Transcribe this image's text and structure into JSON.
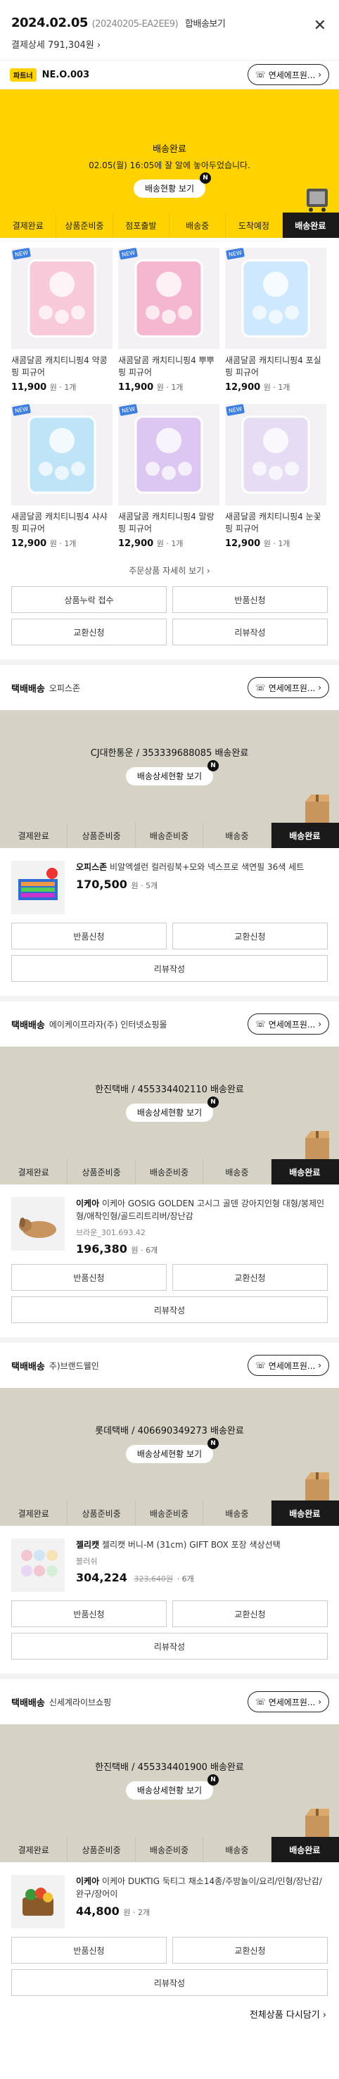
{
  "header": {
    "date": "2024.02.05",
    "order_id": "(20240205-EA2EE9)",
    "merge_label": "합배송보기",
    "total": "결제상세 791,304원",
    "close_icon": "close-icon"
  },
  "store1": {
    "badge": "파트너",
    "name": "NE.O.003",
    "contact": "연세에프원..."
  },
  "status1": {
    "title": "배송완료",
    "sub": "02.05(월) 16:05에 잘 알에 놓아두었습니다.",
    "track": "배송현황 보기",
    "steps": [
      "결제완료",
      "상품준비중",
      "점포출발",
      "배송중",
      "도착예정",
      "배송완료"
    ],
    "active": 5
  },
  "grid_items": [
    {
      "name": "새콤달콤 캐치티니핑4 약콩 핑 피규어",
      "price": "11,900",
      "unit": "원 · 1개"
    },
    {
      "name": "새콤달콤 캐치티니핑4 뿌뿌 핑 피규어",
      "price": "11,900",
      "unit": "원 · 1개"
    },
    {
      "name": "새콤달콤 캐치티니핑4 포실 핑 피규어",
      "price": "12,900",
      "unit": "원 · 1개"
    },
    {
      "name": "새콤달콤 캐치티니핑4 샤샤 핑 피규어",
      "price": "12,900",
      "unit": "원 · 1개"
    },
    {
      "name": "새콤달콤 캐치티니핑4 말랑 핑 피규어",
      "price": "12,900",
      "unit": "원 · 1개"
    },
    {
      "name": "새콤달콤 캐치티니핑4 눈꽃 핑 피규어",
      "price": "12,900",
      "unit": "원 · 1개"
    }
  ],
  "grid_more": "주문상품 자세히 보기 ›",
  "grid_buttons": [
    "상품누락 접수",
    "반품신청",
    "교환신청",
    "리뷰작성"
  ],
  "sections": [
    {
      "type_label": "택배배송",
      "seller": "오피스존",
      "contact": "연세에프원...",
      "tracking": "CJ대한통운 / 353339688085 배송완료",
      "track": "배송상세현황 보기",
      "steps": [
        "결제완료",
        "상품준비중",
        "배송준비중",
        "배송중",
        "배송완료"
      ],
      "product_brand": "오피스존",
      "product_name": "비알엑셀런 컬러링북+모와 넥스프로 색연필 36색 세트",
      "option": "",
      "price": "170,500",
      "orig": "",
      "unit": "원 · 5개",
      "buttons": [
        "반품신청",
        "교환신청",
        "리뷰작성"
      ]
    },
    {
      "type_label": "택배배송",
      "seller": "에이케이프라자(주) 인터넷쇼핑몰",
      "contact": "연세에프원...",
      "tracking": "한진택배 / 455334402110 배송완료",
      "track": "배송상세현황 보기",
      "steps": [
        "결제완료",
        "상품준비중",
        "배송준비중",
        "배송중",
        "배송완료"
      ],
      "product_brand": "이케아",
      "product_name": "이케아 GOSIG GOLDEN 고시그 골덴 강아지인형 대형/봉제인형/애착인형/골드리트리버/장난감",
      "option": "브라운_301.693.42",
      "price": "196,380",
      "orig": "",
      "unit": "원 · 6개",
      "buttons": [
        "반품신청",
        "교환신청",
        "리뷰작성"
      ]
    },
    {
      "type_label": "택배배송",
      "seller": "주)브랜드웰인",
      "contact": "연세에프원...",
      "tracking": "롯데택배 / 406690349273 배송완료",
      "track": "배송상세현황 보기",
      "steps": [
        "결제완료",
        "상품준비중",
        "배송준비중",
        "배송중",
        "배송완료"
      ],
      "product_brand": "젤리캣",
      "product_name": "젤리캣 버니-M (31cm) GIFT BOX 포장 색상선택",
      "option": "블러쉬",
      "price": "304,224",
      "orig": "323,640원",
      "unit": "· 6개",
      "buttons": [
        "반품신청",
        "교환신청",
        "리뷰작성"
      ]
    },
    {
      "type_label": "택배배송",
      "seller": "신세계라이브쇼핑",
      "contact": "연세에프원...",
      "tracking": "한진택배 / 455334401900 배송완료",
      "track": "배송상세현황 보기",
      "steps": [
        "결제완료",
        "상품준비중",
        "배송준비중",
        "배송중",
        "배송완료"
      ],
      "product_brand": "이케아",
      "product_name": "이케아 DUKTIG 둑티그 채소14종/주방놀이/요리/인형/장난감/완구/장어이",
      "option": "",
      "price": "44,800",
      "orig": "",
      "unit": "원 · 2개",
      "buttons": [
        "반품신청",
        "교환신청",
        "리뷰작성"
      ]
    }
  ],
  "footer": "전체상품 다시담기 ›"
}
